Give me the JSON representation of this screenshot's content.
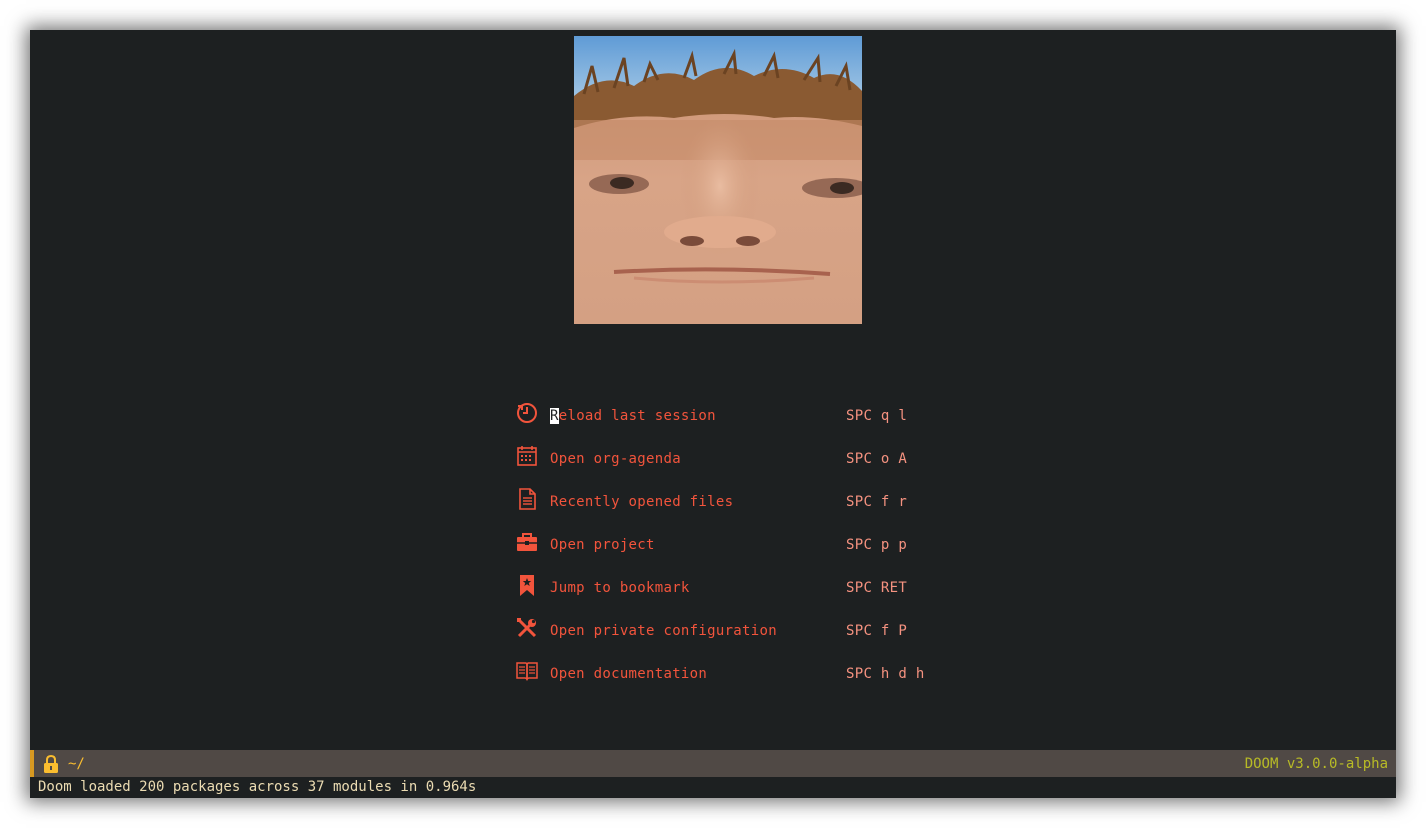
{
  "menu": [
    {
      "icon": "reload-icon",
      "label_first": "R",
      "label_rest": "eload last session",
      "key": "SPC q l"
    },
    {
      "icon": "calendar-icon",
      "label_first": "",
      "label_rest": "Open org-agenda",
      "key": "SPC o A"
    },
    {
      "icon": "file-icon",
      "label_first": "",
      "label_rest": "Recently opened files",
      "key": "SPC f r"
    },
    {
      "icon": "briefcase-icon",
      "label_first": "",
      "label_rest": "Open project",
      "key": "SPC p p"
    },
    {
      "icon": "bookmark-icon",
      "label_first": "",
      "label_rest": "Jump to bookmark",
      "key": "SPC RET"
    },
    {
      "icon": "tools-icon",
      "label_first": "",
      "label_rest": "Open private configuration",
      "key": "SPC f P"
    },
    {
      "icon": "book-icon",
      "label_first": "",
      "label_rest": "Open documentation",
      "key": "SPC h d h"
    }
  ],
  "modeline": {
    "path": "~/",
    "version": "DOOM v3.0.0-alpha"
  },
  "echo": {
    "message": "Doom loaded 200 packages across 37 modules in 0.964s"
  },
  "colors": {
    "background": "#1d2021",
    "menu_label": "#f2543c",
    "menu_key": "#f59280",
    "modeline_bg": "#504945",
    "modeline_path": "#fabd2f",
    "modeline_version": "#b8bb26"
  }
}
